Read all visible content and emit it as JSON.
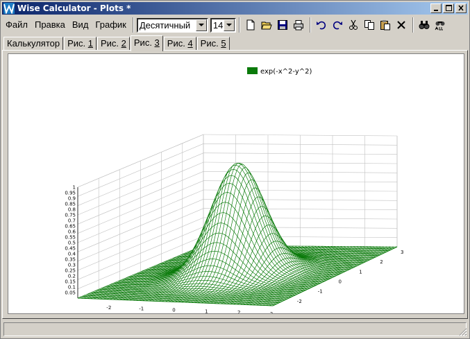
{
  "window": {
    "title": "Wise Calculator - Plots *"
  },
  "menu": [
    {
      "label": "Файл"
    },
    {
      "label": "Правка"
    },
    {
      "label": "Вид"
    },
    {
      "label": "График"
    }
  ],
  "toolbar": {
    "format_value": "Десятичный",
    "precision_value": "14",
    "buttons": [
      "new-icon",
      "open-icon",
      "save-icon",
      "print-icon",
      "undo-icon",
      "redo-icon",
      "cut-icon",
      "copy-icon",
      "paste-icon",
      "delete-icon",
      "find-icon",
      "replace-icon"
    ]
  },
  "tabs": [
    {
      "pre": "Калькулятор",
      "num": ""
    },
    {
      "pre": "Рис. ",
      "num": "1"
    },
    {
      "pre": "Рис. ",
      "num": "2"
    },
    {
      "pre": "Рис. ",
      "num": "3",
      "active": true
    },
    {
      "pre": "Рис. ",
      "num": "4"
    },
    {
      "pre": "Рис. ",
      "num": "5"
    }
  ],
  "colors": {
    "surface": "#0a7a0a",
    "legend": "#0a7a0a",
    "grid": "#c0c0c0",
    "titlebar": "#0a246a"
  },
  "chart_data": {
    "type": "surface",
    "function": "exp(-x^2-y^2)",
    "legend": [
      "exp(-x^2-y^2)"
    ],
    "xlim": [
      -3,
      3
    ],
    "ylim": [
      -3,
      3
    ],
    "zlim": [
      0,
      1
    ],
    "x_ticks": [
      "-2",
      "-1",
      "0",
      "1",
      "2",
      "3"
    ],
    "y_ticks": [
      "-2",
      "-1",
      "0",
      "1",
      "2",
      "3"
    ],
    "z_ticks": [
      "0.05",
      "0.1",
      "0.15",
      "0.2",
      "0.25",
      "0.3",
      "0.35",
      "0.4",
      "0.45",
      "0.5",
      "0.55",
      "0.6",
      "0.65",
      "0.7",
      "0.75",
      "0.8",
      "0.85",
      "0.9",
      "0.95",
      "1"
    ],
    "grid": true,
    "legend_position": "top-center"
  }
}
